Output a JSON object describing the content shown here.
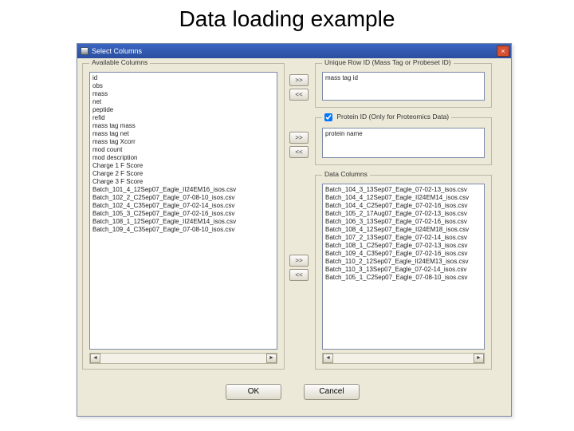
{
  "slide": {
    "title": "Data loading example"
  },
  "dialog": {
    "title": "Select Columns",
    "groups": {
      "available": "Available Columns",
      "unique": "Unique Row ID (Mass Tag or Probeset ID)",
      "protein": "Protein ID (Only for Proteomics Data)",
      "protein_checked": true,
      "data": "Data Columns"
    },
    "transfer": {
      "right": ">>",
      "left": "<<"
    },
    "available_items": [
      "id",
      "obs",
      "mass",
      "net",
      "peptide",
      "refid",
      "mass tag mass",
      "mass tag net",
      "mass tag Xcorr",
      "mod count",
      "mod description",
      "Charge 1 F Score",
      "Charge 2 F Score",
      "Charge 3 F Score",
      "Batch_101_4_12Sep07_Eagle_II24EM16_isos.csv",
      "Batch_102_2_C25ep07_Eagle_07-08-10_isos.csv",
      "Batch_102_4_C35ep07_Eagle_07-02-14_isos.csv",
      "Batch_105_3_C25ep07_Eagle_07-02-16_isos.csv",
      "Batch_108_1_12Sep07_Eagle_II24EM14_isos.csv",
      "Batch_109_4_C35ep07_Eagle_07-08-10_isos.csv"
    ],
    "unique_items": [
      "mass tag id"
    ],
    "protein_items": [
      "protein name"
    ],
    "data_items": [
      "Batch_104_3_13Sep07_Eagle_07-02-13_isos.csv",
      "Batch_104_4_12Sep07_Eagle_II24EM14_isos.csv",
      "Batch_104_4_C25ep07_Eagle_07-02-16_isos.csv",
      "Batch_105_2_17Aug07_Eagle_07-02-13_isos.csv",
      "Batch_106_3_13Sep07_Eagle_07-02-16_isos.csv",
      "Batch_108_4_12Sep07_Eagle_II24EM18_isos.csv",
      "Batch_107_2_13Sep07_Eagle_07-02-14_isos.csv",
      "Batch_108_1_C25ep07_Eagle_07-02-13_isos.csv",
      "Batch_109_4_C35ep07_Eagle_07-02-16_isos.csv",
      "Batch_110_2_12Sep07_Eagle_II24EM13_isos.csv",
      "Batch_110_3_13Sep07_Eagle_07-02-14_isos.csv",
      "Batch_105_1_C25ep07_Eagle_07-08-10_isos.csv"
    ],
    "buttons": {
      "ok": "OK",
      "cancel": "Cancel"
    }
  }
}
